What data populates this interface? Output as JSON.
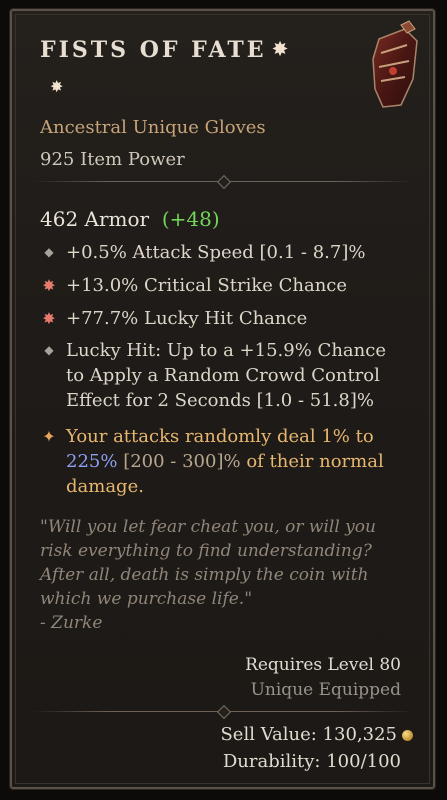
{
  "item": {
    "name": "FISTS OF FATE",
    "type": "Ancestral Unique Gloves",
    "item_power": "925 Item Power",
    "armor_value": "462 Armor",
    "armor_bonus": "(+48)",
    "affixes": [
      {
        "bullet": "diamond-icon",
        "text": "+0.5% Attack Speed [0.1 - 8.7]%"
      },
      {
        "bullet": "greater-affix-star-icon",
        "text": "+13.0% Critical Strike Chance"
      },
      {
        "bullet": "greater-affix-star-icon",
        "text": "+77.7% Lucky Hit Chance"
      },
      {
        "bullet": "diamond-icon",
        "text": "Lucky Hit: Up to a +15.9% Chance to Apply a Random Crowd Control Effect for 2 Seconds [1.0 - 51.8]%"
      }
    ],
    "unique_power": {
      "bullet": "unique-star-icon",
      "part1": "Your attacks randomly deal 1% to",
      "highlight": "225%",
      "range": "[200 - 300]%",
      "part2": "of their normal damage."
    },
    "flavor_text": "\"Will you let fear cheat you, or will you risk everything to find understanding? After all, death is simply the coin with which we purchase life.\"",
    "flavor_author": "- Zurke",
    "requires_level": "Requires Level 80",
    "equipped_status": "Unique Equipped",
    "sell_value": "Sell Value: 130,325",
    "durability": "Durability: 100/100"
  },
  "colors": {
    "unique_gold": "#e6b76e",
    "bonus_green": "#72d55a",
    "highlight_blue": "#8e9df0",
    "greater_affix_red": "#e57a6f"
  }
}
